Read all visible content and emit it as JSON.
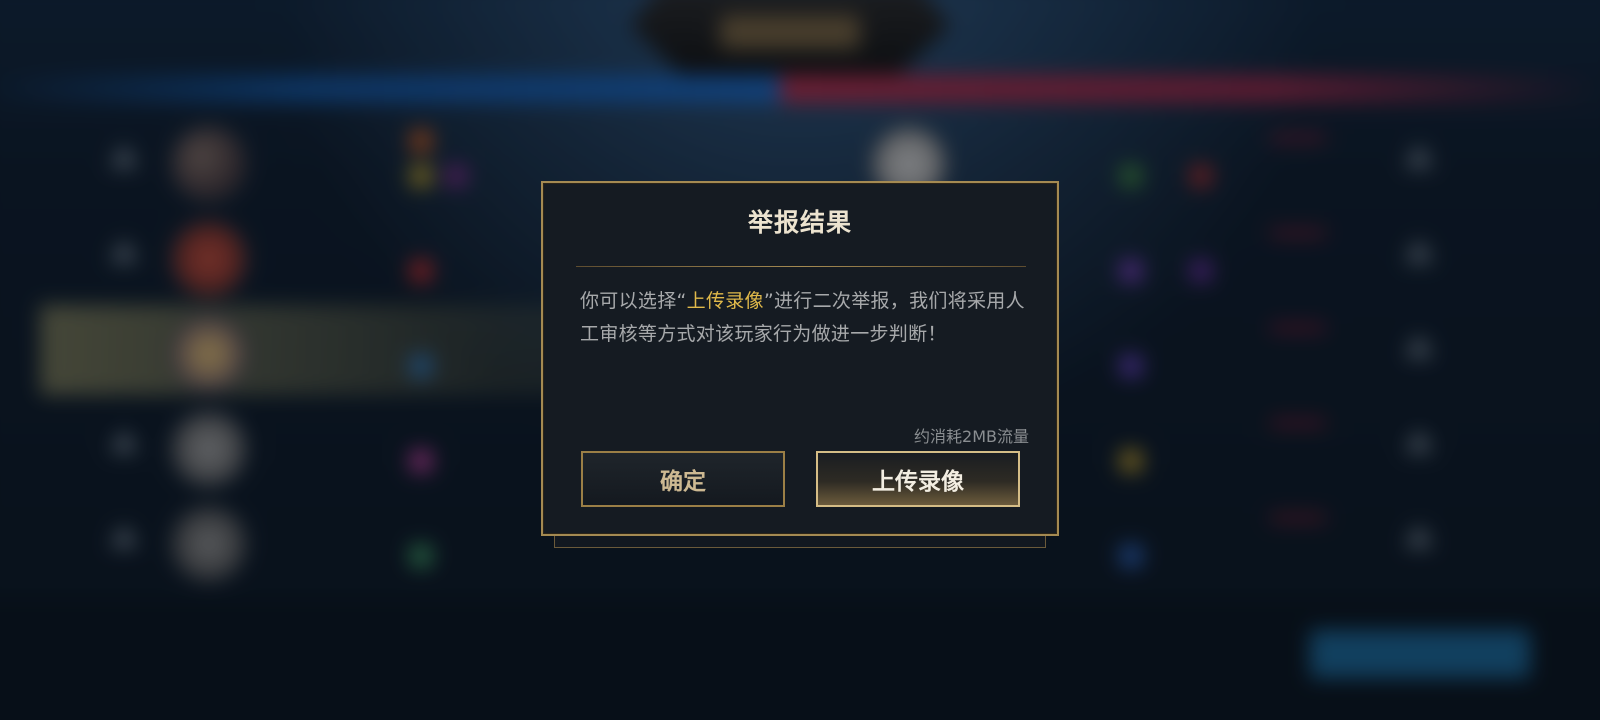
{
  "dialog": {
    "title": "举报结果",
    "message_parts": {
      "before": "你可以选择“",
      "highlight": "上传录像",
      "after": "”进行二次举报，我们将采用人工审核等方式对该玩家行为做进一步判断！"
    },
    "data_note": "约消耗2MB流量",
    "confirm_label": "确定",
    "upload_label": "上传录像"
  },
  "colors": {
    "accent_gold": "#e0b94a",
    "dialog_border": "#a48a52",
    "team_blue": "#1b5fb0",
    "team_red": "#a12c48"
  }
}
